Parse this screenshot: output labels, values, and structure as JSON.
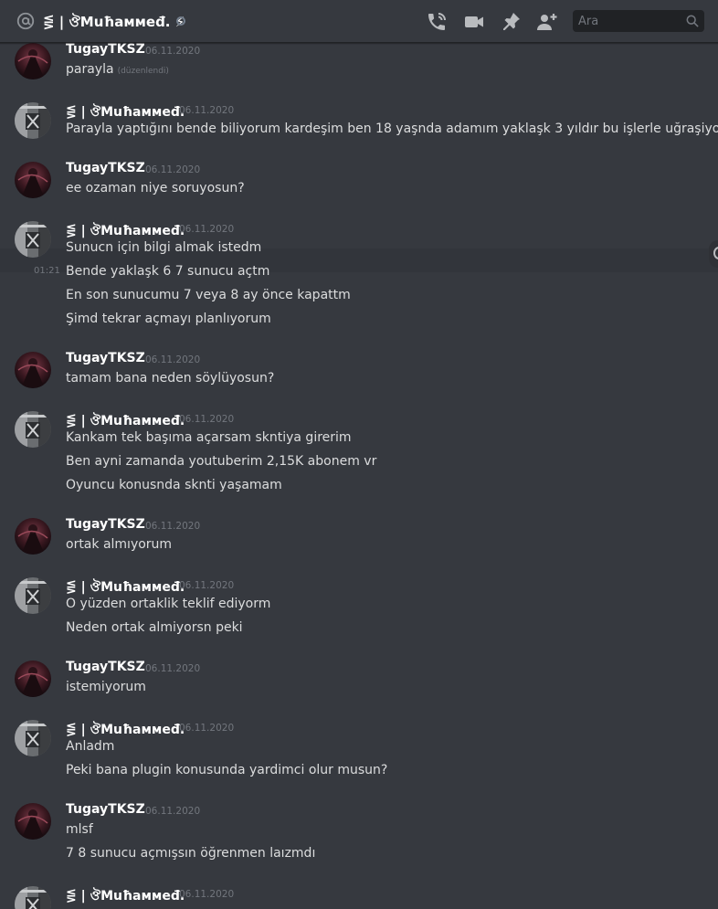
{
  "header": {
    "channel_title": "⋚ | ঔMuħаммеđ. ⚡",
    "search_placeholder": "Ara"
  },
  "colors": {
    "background": "#36393f",
    "header_border": "#202225",
    "username": "#ffffff",
    "timestamp": "#72767d",
    "message_text": "#dcddde"
  },
  "messages": [
    {
      "author": "TugayTKSZ",
      "date": "06.11.2020",
      "lines": [
        "parayla"
      ],
      "edited_label": "(düzenlendi)"
    },
    {
      "author": "⋚ | ঔMuħаммеđ.",
      "date": "06.11.2020",
      "lines": [
        "Parayla yaptığını bende biliyorum kardeşim ben 18 yaşnda adamım yaklaşk 3 yıldır bu işlerle uğraşiyorum"
      ]
    },
    {
      "author": "TugayTKSZ",
      "date": "06.11.2020",
      "lines": [
        "ee ozaman niye soruyosun?"
      ]
    },
    {
      "author": "⋚ | ঔMuħаммеđ.",
      "date": "06.11.2020",
      "lines": [
        "Sunucn için bilgi almak istedm",
        "Bende yaklaşk 6 7 sunucu açtm",
        "En son sunucumu 7 veya 8 ay önce kapattm",
        "Şimd tekrar açmayı planlıyorum"
      ],
      "hover_time": "01:21"
    },
    {
      "author": "TugayTKSZ",
      "date": "06.11.2020",
      "lines": [
        "tamam bana neden söylüyosun?"
      ]
    },
    {
      "author": "⋚ | ঔMuħаммеđ.",
      "date": "06.11.2020",
      "lines": [
        "Kankam tek başıma açarsam skntiya girerim",
        "Ben ayni zamanda youtuberim 2,15K abonem vr",
        "Oyuncu konusnda sknti yaşamam"
      ]
    },
    {
      "author": "TugayTKSZ",
      "date": "06.11.2020",
      "lines": [
        "ortak almıyorum"
      ]
    },
    {
      "author": "⋚ | ঔMuħаммеđ.",
      "date": "06.11.2020",
      "lines": [
        "O yüzden ortaklik teklif ediyorm",
        "Neden ortak almiyorsn peki"
      ]
    },
    {
      "author": "TugayTKSZ",
      "date": "06.11.2020",
      "lines": [
        "istemiyorum"
      ]
    },
    {
      "author": "⋚ | ঔMuħаммеđ.",
      "date": "06.11.2020",
      "lines": [
        "Anladm",
        "Peki bana plugin konusunda yardimci olur musun?"
      ]
    },
    {
      "author": "TugayTKSZ",
      "date": "06.11.2020",
      "lines": [
        "mlsf",
        "7 8 sunucu açmışsın öğrenmen laızmdı"
      ]
    },
    {
      "author": "⋚ | ঔMuħаммеđ.",
      "date": "06.11.2020",
      "lines": []
    }
  ]
}
